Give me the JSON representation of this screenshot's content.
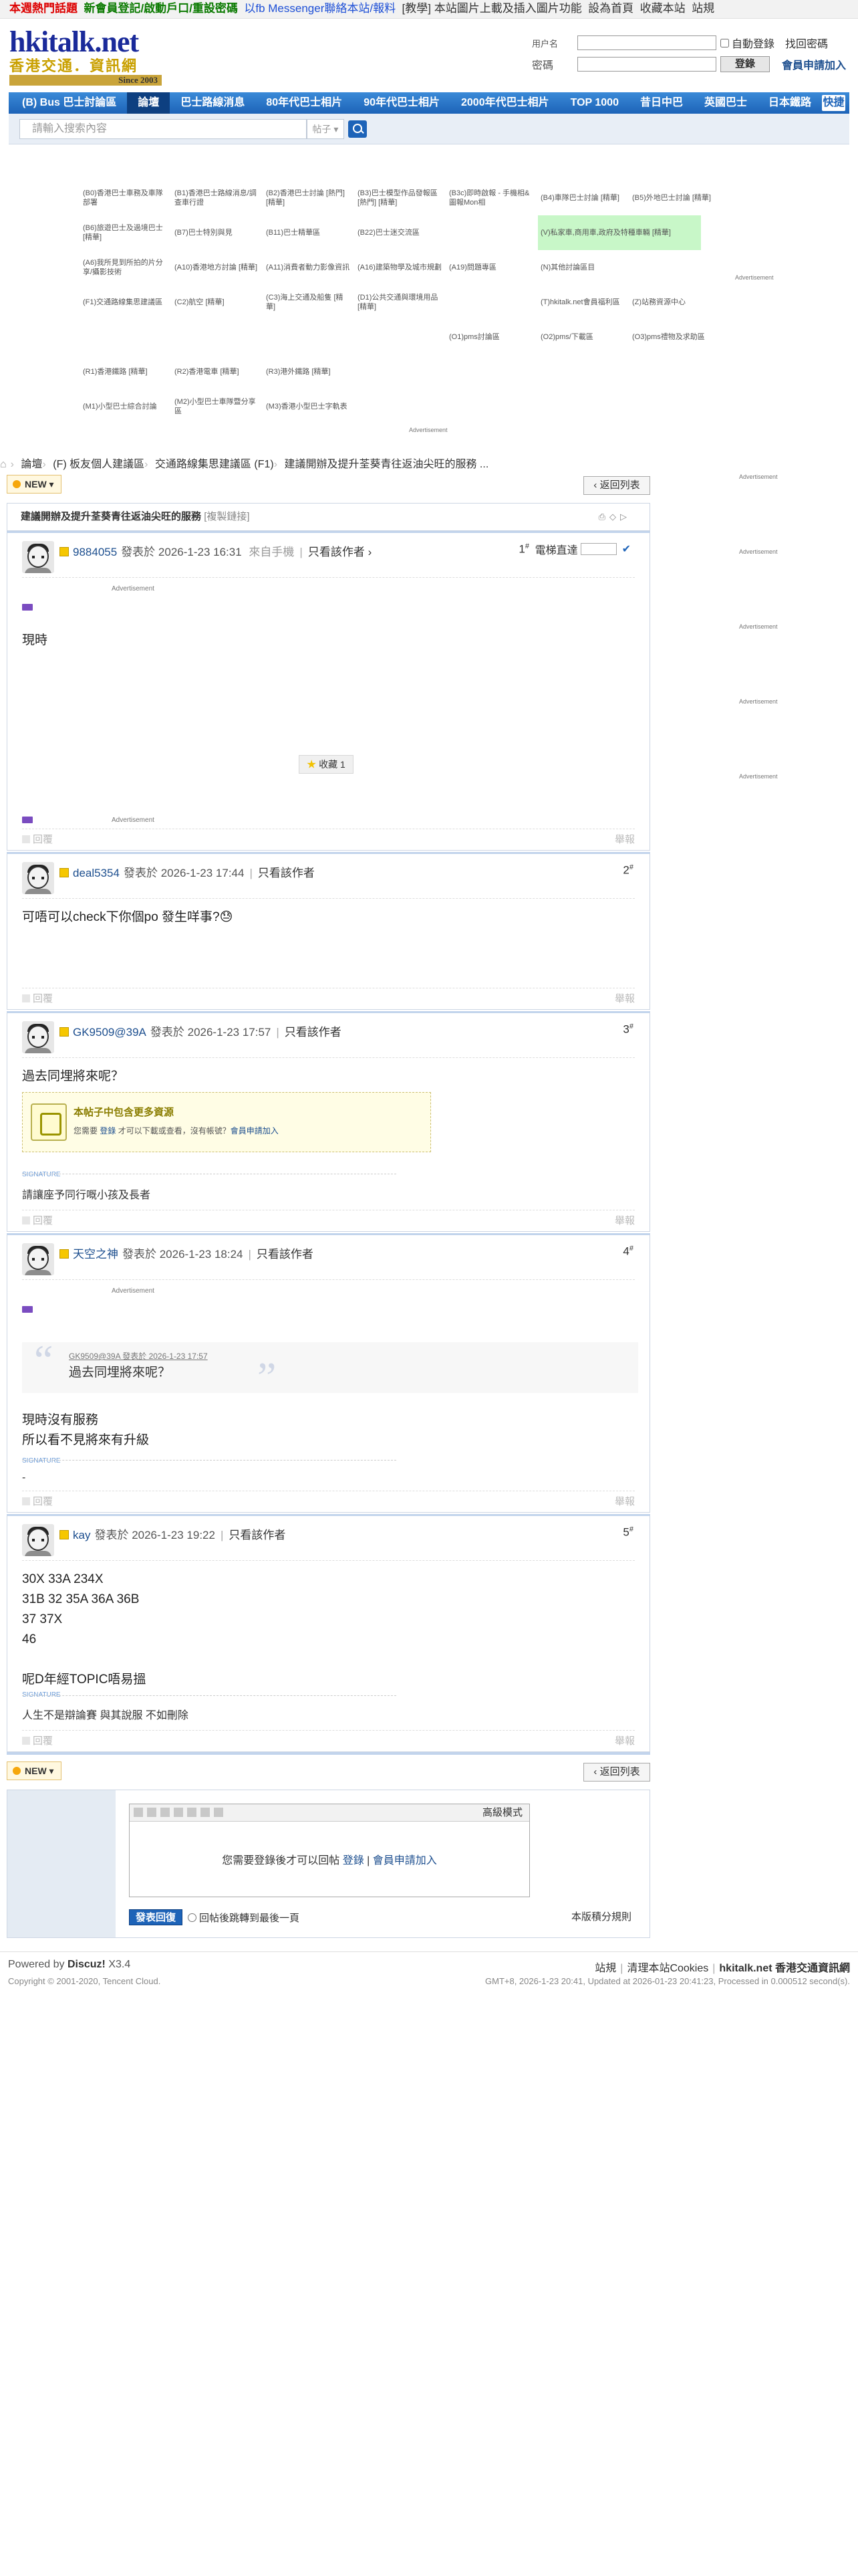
{
  "topbar": {
    "hot": "本週熱門話題",
    "signup": "新會員登記/啟動戶口/重設密碼",
    "fb": "以fb Messenger聯絡本站/報料",
    "tutorial": "[教學] 本站圖片上載及插入圖片功能",
    "homepage": "設為首頁",
    "fav": "收藏本站",
    "rules": "站規"
  },
  "logo": {
    "title": "hkitalk.net",
    "subtitle": "香港交通．資訊網",
    "since": "Since 2003"
  },
  "login": {
    "user_label": "用户名",
    "pass_label": "密碼",
    "auto_login": "自動登錄",
    "forgot": "找回密碼",
    "login_btn": "登錄",
    "register": "會員申請加入"
  },
  "nav": {
    "items": [
      "(B) Bus 巴士討論區",
      "論壇",
      "巴士路線消息",
      "80年代巴士相片",
      "90年代巴士相片",
      "2000年代巴士相片",
      "TOP 1000",
      "昔日中巴",
      "英國巴士",
      "日本鐵路"
    ],
    "quick": "快捷導航"
  },
  "search": {
    "placeholder": "請輸入搜索內容",
    "type": "帖子"
  },
  "forums": [
    [
      "(B0)香港巴士車務及車隊部署",
      "(B1)香港巴士路線消息/調查車行證",
      "(B2)香港巴士討論 [熱門] [精華]",
      "(B3)巴士模型作品發報區 [熱門] [精華]",
      "(B3c)即時啟報 - 手機相&圖報Mon相",
      "(B4)車隊巴士討論 [精華]",
      "(B5)外地巴士討論 [精華]"
    ],
    [
      "(B6)旅遊巴士及過境巴士 [精華]",
      "(B7)巴士特別與見",
      "(B11)巴士精華區",
      "(B22)巴士迷交流區",
      "",
      "(V)私家車,商用車,政府及特種車輛 [精華]",
      ""
    ],
    [
      "(A6)我所見到所拍的片分享/攝影技術",
      "(A10)香港地方討論 [精華]",
      "(A11)消費者動力影像資訊",
      "(A16)建築物學及城市規劃",
      "(A19)問題專區",
      "(N)其他討論區目",
      ""
    ],
    [
      "(F1)交通路線集思建議區",
      "(C2)航空 [精華]",
      "(C3)海上交通及船隻 [精華]",
      "(D1)公共交通與環境用品 [精華]",
      "",
      "(T)hkitalk.net會員福利區",
      "(Z)站務資源中心"
    ],
    [
      "",
      "",
      "",
      "",
      "(O1)pms討論區",
      "(O2)pms/下載區",
      "(O3)pms禮物及求助區"
    ],
    [
      "(R1)香港鐵路 [精華]",
      "(R2)香港電車 [精華]",
      "(R3)港外鐵路 [精華]",
      "",
      "",
      "",
      ""
    ],
    [
      "(M1)小型巴士綜合討論",
      "(M2)小型巴士車隊暨分享區",
      "(M3)香港小型巴士字軌表",
      "",
      "",
      "",
      ""
    ]
  ],
  "ads": {
    "label": "Advertisement"
  },
  "breadcrumb": [
    "論壇",
    "(F) 板友個人建議區",
    "交通路線集思建議區 (F1)",
    "建議開辦及提升荃葵青往返油尖旺的服務 ..."
  ],
  "buttons": {
    "new": "NEW",
    "back": "返回列表"
  },
  "thread": {
    "title": "建議開辦及提升荃葵青往返油尖旺的服務",
    "copy": "[複製鏈接]",
    "jump_label": "電梯直達"
  },
  "posts": [
    {
      "user": "9884055",
      "time": "發表於 2026-1-23 16:31",
      "from": "來自手機",
      "only": "只看該作者",
      "floor": "1",
      "body": [
        "現時"
      ]
    },
    {
      "user": "deal5354",
      "time": "發表於 2026-1-23 17:44",
      "only": "只看該作者",
      "floor": "2",
      "body": [
        "可唔可以check下你個po 發生咩事?😓"
      ]
    },
    {
      "user": "GK9509@39A",
      "time": "發表於 2026-1-23 17:57",
      "only": "只看該作者",
      "floor": "3",
      "body": [
        "過去同埋將來呢？"
      ],
      "sig": "請讓座予同行嘅小孩及長者"
    },
    {
      "user": "天空之神",
      "time": "發表於 2026-1-23 18:24",
      "only": "只看該作者",
      "floor": "4",
      "quote_author": "GK9509@39A 發表於 2026-1-23 17:57",
      "quote_text": "過去同埋將來呢？",
      "body": [
        "現時沒有服務",
        "所以看不見將來有升級"
      ],
      "sig": "-"
    },
    {
      "user": "kay",
      "time": "發表於 2026-1-23 19:22",
      "only": "只看該作者",
      "floor": "5",
      "body": [
        "30X 33A 234X",
        "31B 32 35A 36A 36B",
        "37 37X",
        "46",
        "",
        "呢D年經TOPIC唔易搵"
      ],
      "sig": "人生不是辯論賽 與其說服 不如刪除"
    }
  ],
  "post_common": {
    "reply": "回覆",
    "report": "舉報",
    "fav": "收藏",
    "sig_label": "SIGNATURE"
  },
  "lockbox": {
    "title": "本帖子中包含更多資源",
    "text_pre": "您需要",
    "login": "登錄",
    "text_mid": "才可以下載或查看，沒有帳號？",
    "register": "會員申請加入"
  },
  "reply_form": {
    "advanced": "高級模式",
    "notice_pre": "您需要登錄後才可以回帖",
    "login": "登錄",
    "sep": "|",
    "register": "會員申請加入",
    "submit": "發表回復",
    "jump_last": "回帖後跳轉到最後一頁",
    "rules": "本版積分規則"
  },
  "footer": {
    "powered": "Powered by",
    "product": "Discuz!",
    "version": "X3.4",
    "copyright": "Copyright © 2001-2020, Tencent Cloud.",
    "links": [
      "站規",
      "清理本站Cookies",
      "hkitalk.net 香港交通資訊網"
    ],
    "status": "GMT+8, 2026-1-23 20:41, Updated at 2026-01-23 20:41:23, Processed in 0.000512 second(s)."
  }
}
